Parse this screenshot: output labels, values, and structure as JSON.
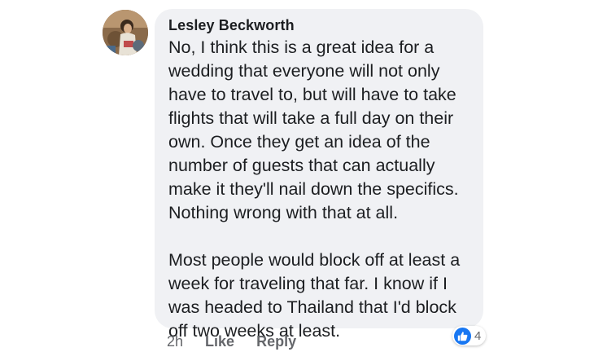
{
  "comment": {
    "author": "Lesley Beckworth",
    "paragraphs": [
      [
        "No, I think this is a great idea for a",
        "wedding that everyone will not only",
        "have to travel to, but will have to take",
        "flights that will take a full day on their",
        "own. Once they get an idea of the",
        "number of guests that can actually",
        "make it they'll nail down the specifics.",
        "Nothing wrong with that at all."
      ],
      [
        "Most people would block off at least a",
        "week for traveling that far. I know if I",
        "was headed to Thailand that I'd block",
        "off two weeks at least."
      ]
    ],
    "timestamp": "2h",
    "actions": {
      "like": "Like",
      "reply": "Reply"
    },
    "reactions": {
      "icon": "thumbs-up-icon",
      "count": "4"
    }
  },
  "colors": {
    "bubble": "#f0f1f4",
    "text": "#1c1e21",
    "meta": "#65676b",
    "like_badge": "#1877f2"
  }
}
